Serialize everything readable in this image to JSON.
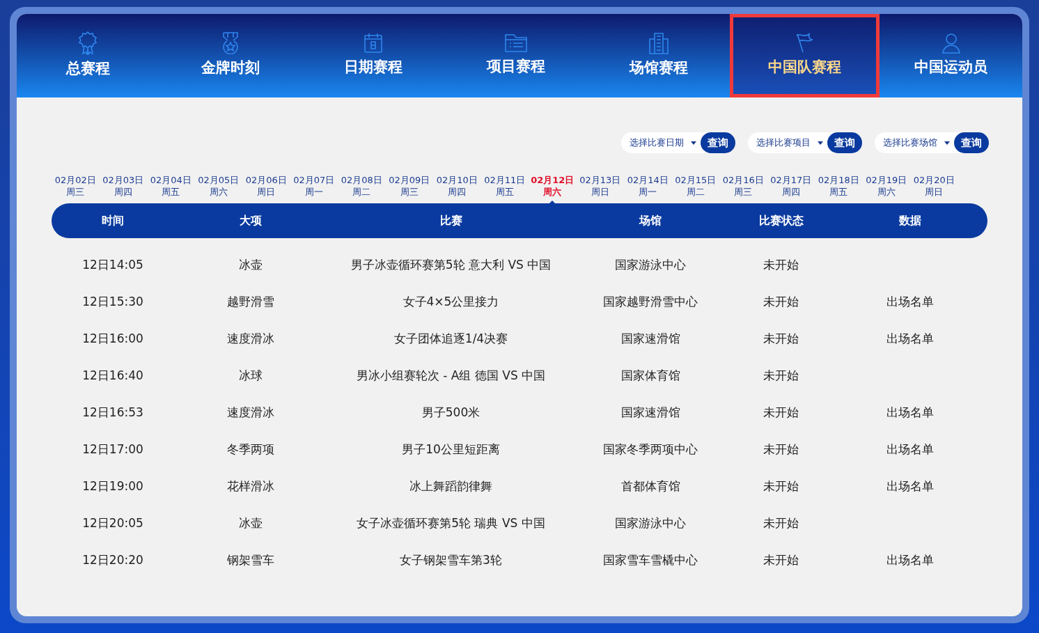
{
  "tabs": [
    {
      "label": "总赛程",
      "selected": false,
      "outlined": false
    },
    {
      "label": "金牌时刻",
      "selected": false,
      "outlined": false
    },
    {
      "label": "日期赛程",
      "selected": false,
      "outlined": false
    },
    {
      "label": "项目赛程",
      "selected": false,
      "outlined": false
    },
    {
      "label": "场馆赛程",
      "selected": false,
      "outlined": false
    },
    {
      "label": "中国队赛程",
      "selected": true,
      "outlined": true
    },
    {
      "label": "中国运动员",
      "selected": false,
      "outlined": false
    }
  ],
  "filters": [
    {
      "placeholder": "选择比赛日期",
      "button": "查询"
    },
    {
      "placeholder": "选择比赛项目",
      "button": "查询"
    },
    {
      "placeholder": "选择比赛场馆",
      "button": "查询"
    }
  ],
  "dates": [
    {
      "date": "02月02日",
      "weekday": "周三",
      "selected": false
    },
    {
      "date": "02月03日",
      "weekday": "周四",
      "selected": false
    },
    {
      "date": "02月04日",
      "weekday": "周五",
      "selected": false
    },
    {
      "date": "02月05日",
      "weekday": "周六",
      "selected": false
    },
    {
      "date": "02月06日",
      "weekday": "周日",
      "selected": false
    },
    {
      "date": "02月07日",
      "weekday": "周一",
      "selected": false
    },
    {
      "date": "02月08日",
      "weekday": "周二",
      "selected": false
    },
    {
      "date": "02月09日",
      "weekday": "周三",
      "selected": false
    },
    {
      "date": "02月10日",
      "weekday": "周四",
      "selected": false
    },
    {
      "date": "02月11日",
      "weekday": "周五",
      "selected": false
    },
    {
      "date": "02月12日",
      "weekday": "周六",
      "selected": true
    },
    {
      "date": "02月13日",
      "weekday": "周日",
      "selected": false
    },
    {
      "date": "02月14日",
      "weekday": "周一",
      "selected": false
    },
    {
      "date": "02月15日",
      "weekday": "周二",
      "selected": false
    },
    {
      "date": "02月16日",
      "weekday": "周三",
      "selected": false
    },
    {
      "date": "02月17日",
      "weekday": "周四",
      "selected": false
    },
    {
      "date": "02月18日",
      "weekday": "周五",
      "selected": false
    },
    {
      "date": "02月19日",
      "weekday": "周六",
      "selected": false
    },
    {
      "date": "02月20日",
      "weekday": "周日",
      "selected": false
    }
  ],
  "table": {
    "columns": [
      "时间",
      "大项",
      "比赛",
      "场馆",
      "比赛状态",
      "数据"
    ],
    "rows": [
      [
        "12日14:05",
        "冰壶",
        "男子冰壶循环赛第5轮 意大利 VS 中国",
        "国家游泳中心",
        "未开始",
        ""
      ],
      [
        "12日15:30",
        "越野滑雪",
        "女子4×5公里接力",
        "国家越野滑雪中心",
        "未开始",
        "出场名单"
      ],
      [
        "12日16:00",
        "速度滑冰",
        "女子团体追逐1/4决赛",
        "国家速滑馆",
        "未开始",
        "出场名单"
      ],
      [
        "12日16:40",
        "冰球",
        "男冰小组赛轮次 - A组 德国 VS 中国",
        "国家体育馆",
        "未开始",
        ""
      ],
      [
        "12日16:53",
        "速度滑冰",
        "男子500米",
        "国家速滑馆",
        "未开始",
        "出场名单"
      ],
      [
        "12日17:00",
        "冬季两项",
        "男子10公里短距离",
        "国家冬季两项中心",
        "未开始",
        "出场名单"
      ],
      [
        "12日19:00",
        "花样滑冰",
        "冰上舞蹈韵律舞",
        "首都体育馆",
        "未开始",
        "出场名单"
      ],
      [
        "12日20:05",
        "冰壶",
        "女子冰壶循环赛第5轮 瑞典 VS 中国",
        "国家游泳中心",
        "未开始",
        ""
      ],
      [
        "12日20:20",
        "钢架雪车",
        "女子钢架雪车第3轮",
        "国家雪车雪橇中心",
        "未开始",
        "出场名单"
      ]
    ]
  }
}
